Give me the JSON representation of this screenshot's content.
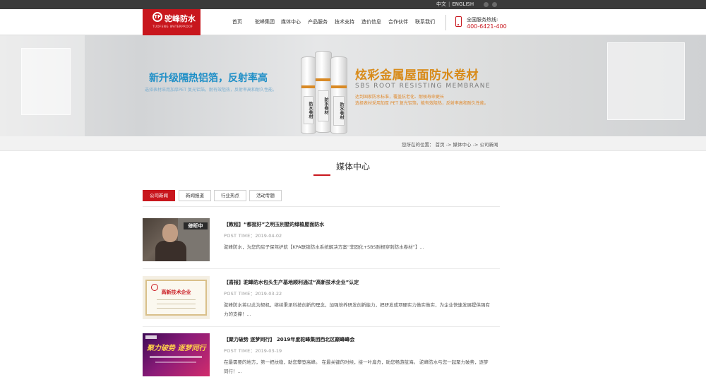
{
  "topbar": {
    "lang_cn": "中文",
    "lang_sep": "|",
    "lang_en": "ENGLISH"
  },
  "header": {
    "logo_text": "驼峰防水",
    "logo_sub": "TUOFENG WATERPROOF",
    "logo_mark": "TF",
    "nav": [
      "首页",
      "驼峰集团",
      "媒体中心",
      "产品服务",
      "技术支持",
      "造价信息",
      "合作伙伴",
      "联系我们"
    ],
    "hotline_label": "全国服务热线:",
    "hotline_number": "400-6421-400"
  },
  "banner": {
    "left_title": "新升级隔热铝箔，反射率高",
    "left_desc": "选择表材采用加厚PET 复光铝箔，耐有效阻热，反射率高和耐久性能。",
    "right_title": "炫彩金属屋面防水卷材",
    "right_sub": "SBS ROOT RESISTING MEMBRANE",
    "right_desc1": "达到国家防水标准，覆盖抗老化、耐候寿命更长",
    "right_desc2": "选择表材采用加厚 PET 复光铝箔，能有效阻热，反射率高和耐久性能。",
    "roll_label": "防水卷材"
  },
  "breadcrumb": {
    "prefix": "您所在的位置：",
    "items": [
      "首页",
      "媒体中心",
      "公司新闻"
    ],
    "sep": "->"
  },
  "section": {
    "title": "媒体中心"
  },
  "tabs": [
    "公司新闻",
    "新闻报道",
    "行业热点",
    "活动专题"
  ],
  "articles": [
    {
      "title": "【教程】“都挺好”之明玉别墅的绿植屋面防水",
      "date_label": "POST TIME：",
      "date": "2019-04-02",
      "excerpt": "驼峰防水，为您的房子保驾护航【KPA联锁防水系统解决方案“非固化+SBS耐根穿刺防水卷材”】...",
      "thumb_caption": "修昕中"
    },
    {
      "title": "【喜报】驼峰防水包头生产基地顺利通过“高新技术企业”认定",
      "date_label": "POST TIME：",
      "date": "2019-03-22",
      "excerpt": "驼峰防水将以此为契机，继续秉承科技创新的理念，加强培养研发创新能力，把研发成项硬实力做实做实，为企业快速发展提供强有力的支撑！...",
      "thumb_caption": "高新技术企业"
    },
    {
      "title": "【聚力破势 逐梦同行】 2019年度驼峰集团西北区巅峰峰会",
      "date_label": "POST TIME：",
      "date": "2019-03-19",
      "excerpt": "在最需要的地方，第一把扶稳，助您攀登高峰。 在最关键的时候，接一叶扁舟，助您畅游蓝海。 驼峰防水与您一起聚力破势，逐梦同行！...",
      "thumb_caption": "聚力破势 逐梦同行"
    }
  ]
}
